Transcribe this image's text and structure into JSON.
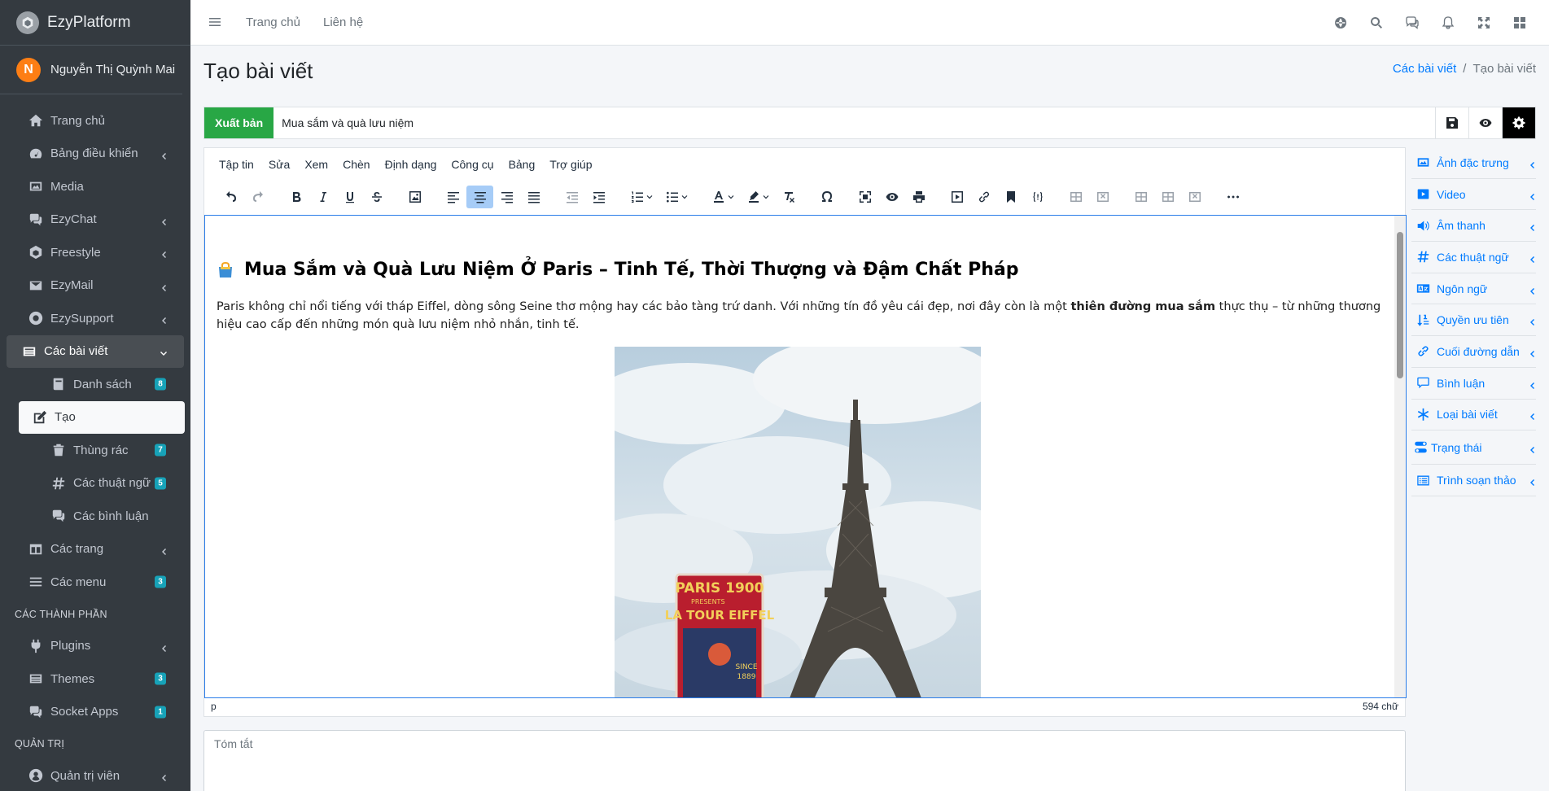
{
  "brand": {
    "name": "EzyPlatform"
  },
  "user": {
    "initial": "N",
    "name": "Nguyễn Thị Quỳnh Mai"
  },
  "sidebar": {
    "items": [
      {
        "label": "Trang chủ"
      },
      {
        "label": "Bảng điều khiển"
      },
      {
        "label": "Media"
      },
      {
        "label": "EzyChat"
      },
      {
        "label": "Freestyle"
      },
      {
        "label": "EzyMail"
      },
      {
        "label": "EzySupport"
      },
      {
        "label": "Các bài viết"
      },
      {
        "label": "Danh sách",
        "badge": "8"
      },
      {
        "label": "Tạo"
      },
      {
        "label": "Thùng rác",
        "badge": "7"
      },
      {
        "label": "Các thuật ngữ",
        "badge": "5"
      },
      {
        "label": "Các bình luận"
      },
      {
        "label": "Các trang"
      },
      {
        "label": "Các menu",
        "badge": "3"
      },
      {
        "label": "Plugins"
      },
      {
        "label": "Themes",
        "badge": "3"
      },
      {
        "label": "Socket Apps",
        "badge": "1"
      },
      {
        "label": "Quản trị viên"
      }
    ],
    "headers": [
      "CÁC THÀNH PHẦN",
      "QUẢN TRỊ"
    ]
  },
  "topbar": {
    "links": [
      "Trang chủ",
      "Liên hệ"
    ]
  },
  "page": {
    "title": "Tạo bài viết"
  },
  "breadcrumb": {
    "parent": "Các bài viết",
    "current": "Tạo bài viết"
  },
  "post": {
    "publish_label": "Xuất bản",
    "title": "Mua sắm và quà lưu niệm"
  },
  "editor": {
    "menu": [
      "Tập tin",
      "Sửa",
      "Xem",
      "Chèn",
      "Định dạng",
      "Công cụ",
      "Bảng",
      "Trợ giúp"
    ],
    "heading": "Mua Sắm và Quà Lưu Niệm Ở Paris – Tinh Tế, Thời Thượng và Đậm Chất Pháp",
    "para_before": "Paris không chỉ nổi tiếng với tháp Eiffel, dòng sông Seine thơ mộng hay các bảo tàng trứ danh. Với những tín đồ yêu cái đẹp, nơi đây còn là một ",
    "para_bold": "thiên đường mua sắm",
    "para_after": " thực thụ – từ những thương hiệu cao cấp đến những món quà lưu niệm nhỏ nhắn, tinh tế.",
    "poster_line1": "PARIS 1900",
    "poster_line2": "PRESENTS",
    "poster_line3": "LA TOUR EIFFEL",
    "poster_since": "SINCE",
    "poster_year": "1889",
    "status_path": "p",
    "word_count": "594 chữ"
  },
  "summary": {
    "placeholder": "Tóm tắt"
  },
  "right_panel": {
    "items": [
      "Ảnh đặc trưng",
      "Video",
      "Âm thanh",
      "Các thuật ngữ",
      "Ngôn ngữ",
      "Quyền ưu tiên",
      "Cuối đường dẫn",
      "Bình luận",
      "Loại bài viết",
      "Trạng thái",
      "Trình soạn thảo"
    ]
  },
  "colors": {
    "sidebar_bg": "#343a40",
    "publish": "#28a745",
    "link": "#007bff",
    "accent_badge": "#17a2b8",
    "avatar": "#fd7e14"
  }
}
